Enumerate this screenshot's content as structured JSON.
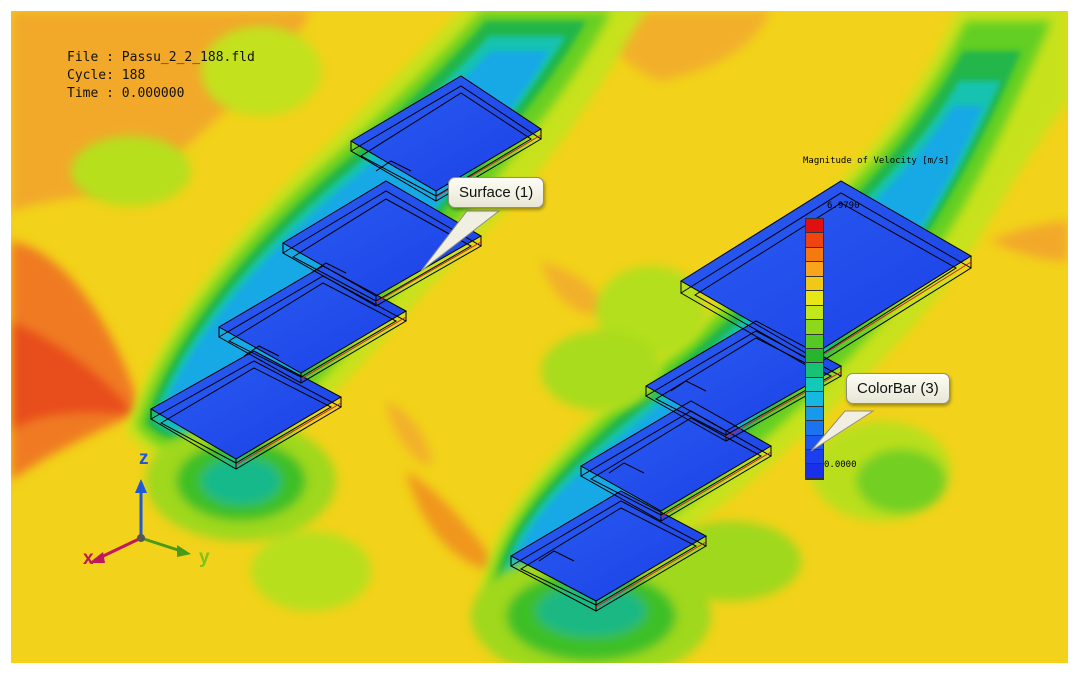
{
  "info": {
    "file": "File : Passu_2_2_188.fld",
    "cycle": "Cycle: 188",
    "time": "Time : 0.000000"
  },
  "callouts": {
    "surface": "Surface (1)",
    "colorbar": "ColorBar (3)"
  },
  "colorbar": {
    "title": "Magnitude of Velocity [m/s]",
    "max_label": "6.9790",
    "min_label": "0.0000",
    "colors": [
      "#e01010",
      "#ee4410",
      "#f47a10",
      "#f9a41a",
      "#f2c818",
      "#e9e618",
      "#c2e71a",
      "#8ed81c",
      "#56c824",
      "#27b52f",
      "#17c275",
      "#15c9b6",
      "#16b8e2",
      "#1899ec",
      "#1a74ef",
      "#1d55ef",
      "#1c3fee",
      "#1a2fe8"
    ]
  },
  "axes": {
    "x": "x",
    "y": "y",
    "z": "z"
  },
  "palette": {
    "background": "#f2d21a",
    "deep_blue": "#1f46ea",
    "cyan": "#15c9e0",
    "green": "#2dbd3a",
    "orange": "#f3a327",
    "red_orange": "#f06a20",
    "outline": "#000000"
  }
}
